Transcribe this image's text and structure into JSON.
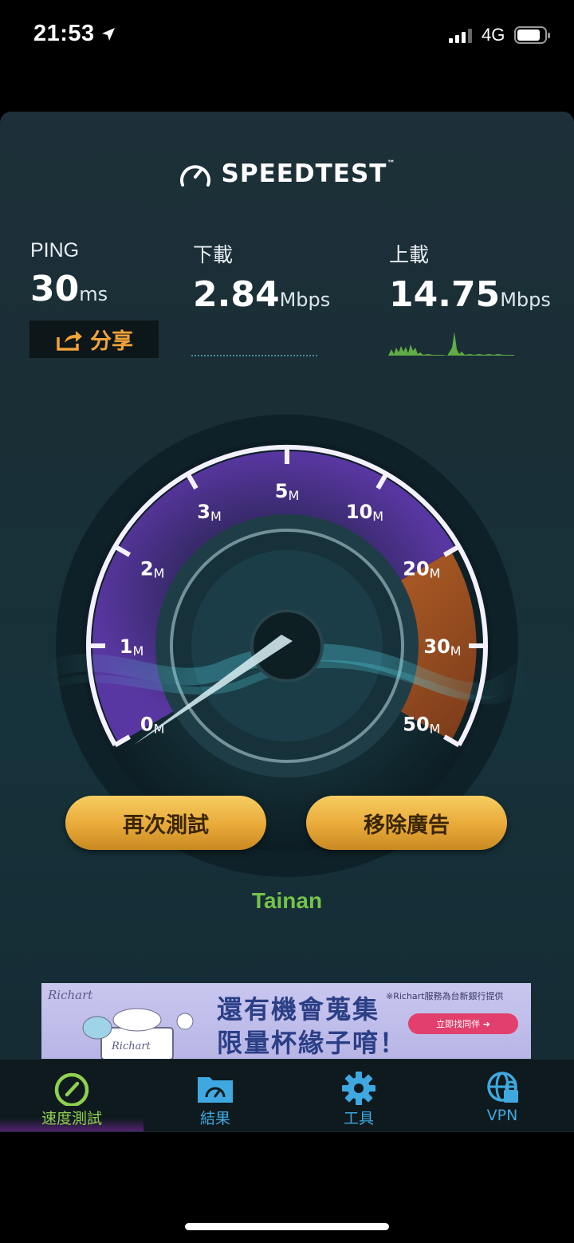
{
  "status_bar": {
    "time": "21:53",
    "network": "4G"
  },
  "app": {
    "logo": "SPEEDTEST",
    "ping": {
      "label": "PING",
      "value": "30",
      "unit": "ms"
    },
    "download": {
      "label": "下載",
      "value": "2.84",
      "unit": "Mbps"
    },
    "upload": {
      "label": "上載",
      "value": "14.75",
      "unit": "Mbps"
    },
    "share_label": "分享",
    "gauge": {
      "ticks": [
        {
          "num": "0",
          "suffix": "M"
        },
        {
          "num": "1",
          "suffix": "M"
        },
        {
          "num": "2",
          "suffix": "M"
        },
        {
          "num": "3",
          "suffix": "M"
        },
        {
          "num": "5",
          "suffix": "M"
        },
        {
          "num": "10",
          "suffix": "M"
        },
        {
          "num": "20",
          "suffix": "M"
        },
        {
          "num": "30",
          "suffix": "M"
        },
        {
          "num": "50",
          "suffix": "M"
        }
      ]
    },
    "buttons": {
      "retest": "再次測試",
      "remove_ads": "移除廣告"
    },
    "server": "Tainan"
  },
  "ad": {
    "brand": "Richart",
    "line1": "還有機會蒐集",
    "line2": "限量杯緣子唷！",
    "note": "※Richart服務為台新銀行提供",
    "cta": "立即找同伴 ➜"
  },
  "tabs": [
    {
      "label": "速度測試",
      "icon": "speedometer-icon",
      "active": true
    },
    {
      "label": "結果",
      "icon": "results-folder-icon",
      "active": false
    },
    {
      "label": "工具",
      "icon": "gear-icon",
      "active": false
    },
    {
      "label": "VPN",
      "icon": "vpn-globe-icon",
      "active": false
    }
  ],
  "colors": {
    "accent_orange": "#f1a339",
    "server_green": "#74c34a",
    "tab_active": "#8fd14f",
    "tab_inactive": "#3fa8e0",
    "gauge_purple": "#4a2b86"
  }
}
